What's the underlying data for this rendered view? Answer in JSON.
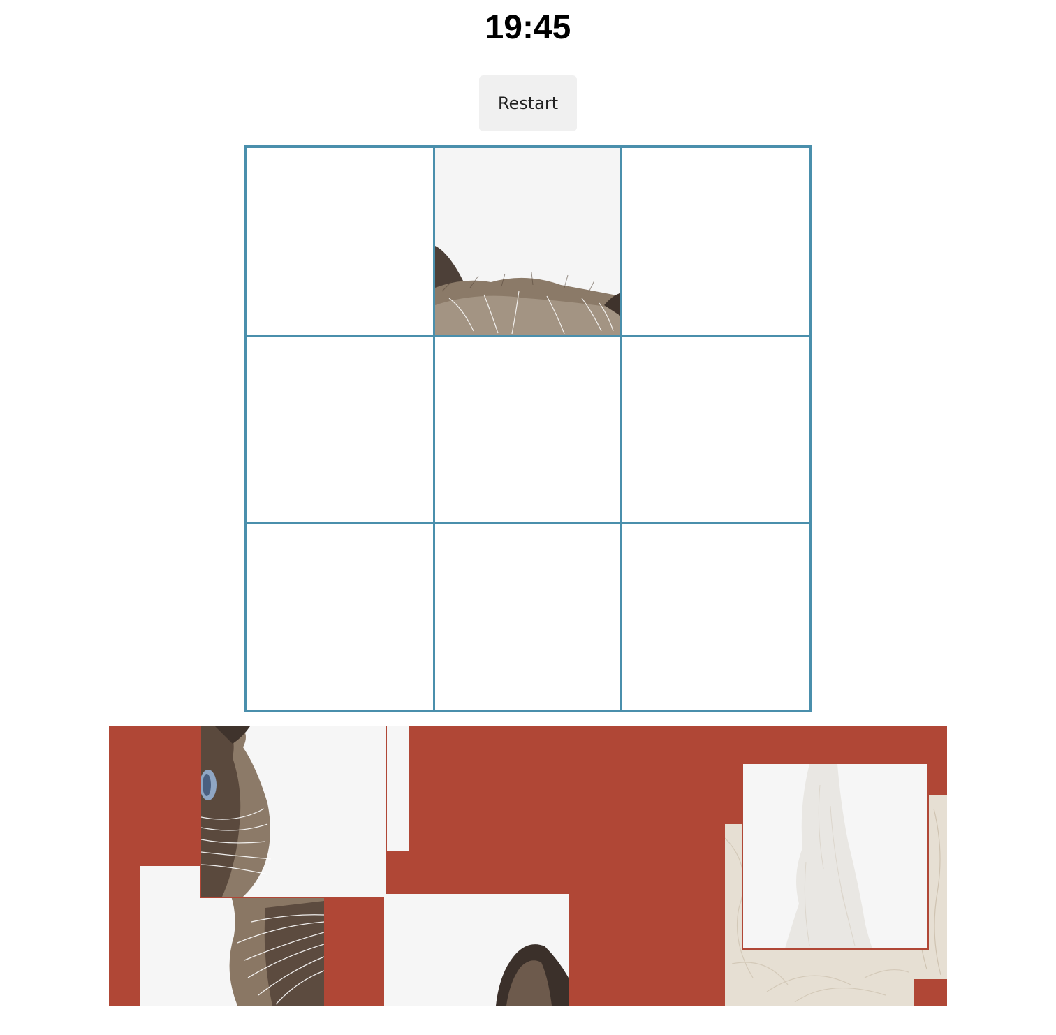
{
  "timer": {
    "text": "19:45"
  },
  "controls": {
    "restart_label": "Restart"
  },
  "colors": {
    "board_border": "#4a8fac",
    "tray_background": "#b04736",
    "button_background": "#f0f0f0",
    "piece_background": "#f6f6f6"
  },
  "board": {
    "rows": 3,
    "cols": 3,
    "cells": [
      {
        "row": 1,
        "col": 1,
        "filled": false
      },
      {
        "row": 1,
        "col": 2,
        "filled": true,
        "piece": "cat-ears-top"
      },
      {
        "row": 1,
        "col": 3,
        "filled": false
      },
      {
        "row": 2,
        "col": 1,
        "filled": false
      },
      {
        "row": 2,
        "col": 2,
        "filled": false
      },
      {
        "row": 2,
        "col": 3,
        "filled": false
      },
      {
        "row": 3,
        "col": 1,
        "filled": false
      },
      {
        "row": 3,
        "col": 2,
        "filled": false
      },
      {
        "row": 3,
        "col": 3,
        "filled": false
      }
    ]
  },
  "tray": {
    "pieces": [
      {
        "id": "piece-blank-back"
      },
      {
        "id": "piece-cat-whiskers-left"
      },
      {
        "id": "piece-cat-eye-left"
      },
      {
        "id": "piece-cat-ear-right"
      },
      {
        "id": "piece-white-fur-back"
      },
      {
        "id": "piece-fur-strip-right"
      },
      {
        "id": "piece-white-fur-front"
      }
    ]
  }
}
